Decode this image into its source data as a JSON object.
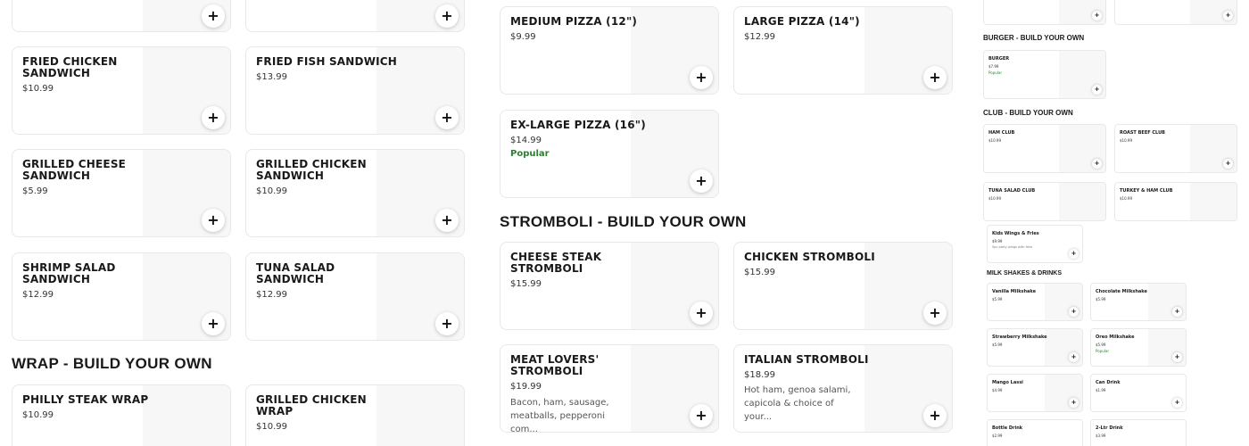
{
  "add_icon": "+",
  "left_column": {
    "section_wrap": "WRAP - BUILD YOUR OWN",
    "items": [
      {
        "name": "",
        "price": ""
      },
      {
        "name": "",
        "price": ""
      },
      {
        "name": "FRIED CHICKEN\nSANDWICH",
        "price": "$10.99"
      },
      {
        "name": "FRIED FISH SANDWICH",
        "price": "$13.99"
      },
      {
        "name": "GRILLED CHEESE\nSANDWICH",
        "price": "$5.99"
      },
      {
        "name": "GRILLED CHICKEN\nSANDWICH",
        "price": "$10.99"
      },
      {
        "name": "SHRIMP SALAD\nSANDWICH",
        "price": "$12.99"
      },
      {
        "name": "TUNA SALAD\nSANDWICH",
        "price": "$12.99"
      },
      {
        "name": "PHILLY STEAK WRAP",
        "price": "$10.99"
      },
      {
        "name": "GRILLED CHICKEN\nWRAP",
        "price": "$10.99"
      }
    ]
  },
  "middle_column": {
    "section_stromboli": "STROMBOLI - BUILD YOUR OWN",
    "items": [
      {
        "name": "MEDIUM PIZZA (12\")",
        "price": "$9.99"
      },
      {
        "name": "LARGE PIZZA (14\")",
        "price": "$12.99"
      },
      {
        "name": "EX-LARGE PIZZA (16\")",
        "price": "$14.99",
        "badge": "Popular"
      },
      {
        "name": "CHEESE STEAK\nSTROMBOLI",
        "price": "$15.99"
      },
      {
        "name": "CHICKEN STROMBOLI",
        "price": "$15.99"
      },
      {
        "name": "MEAT LOVERS'\nSTROMBOLI",
        "price": "$19.99",
        "desc": "Bacon, ham, sausage, meatballs, pepperoni com..."
      },
      {
        "name": "ITALIAN STROMBOLI",
        "price": "$18.99",
        "desc": "Hot ham, genoa salami, capicola & choice of your..."
      }
    ]
  },
  "right_panel": {
    "section_burger": "BURGER - BUILD YOUR OWN",
    "section_club": "CLUB - BUILD YOUR OWN",
    "section_drinks": "MILK SHAKES & DRINKS",
    "burger": {
      "name": "BURGER",
      "price": "$7.99",
      "badge": "Popular"
    },
    "clubs": [
      {
        "name": "HAM CLUB",
        "price": "$10.99"
      },
      {
        "name": "ROAST BEEF CLUB",
        "price": "$10.99"
      },
      {
        "name": "TUNA SALAD CLUB",
        "price": "$10.99"
      },
      {
        "name": "TURKEY & HAM CLUB",
        "price": "$10.99"
      }
    ],
    "kids": {
      "name": "Kids Wings & Fries",
      "price": "$9.99",
      "desc": "5pc party wings with fries"
    },
    "drinks": [
      {
        "name": "Vanilla Milkshake",
        "price": "$5.99"
      },
      {
        "name": "Chocolate Milkshake",
        "price": "$5.99"
      },
      {
        "name": "Strawberry Milkshake",
        "price": "$5.99"
      },
      {
        "name": "Oreo Milkshake",
        "price": "$5.99",
        "badge": "Popular"
      },
      {
        "name": "Mango Lassi",
        "price": "$4.99"
      },
      {
        "name": "Can Drink",
        "price": "$1.99"
      },
      {
        "name": "Bottle Drink",
        "price": "$2.99"
      },
      {
        "name": "2-Ltr Drink",
        "price": "$3.99"
      }
    ]
  }
}
